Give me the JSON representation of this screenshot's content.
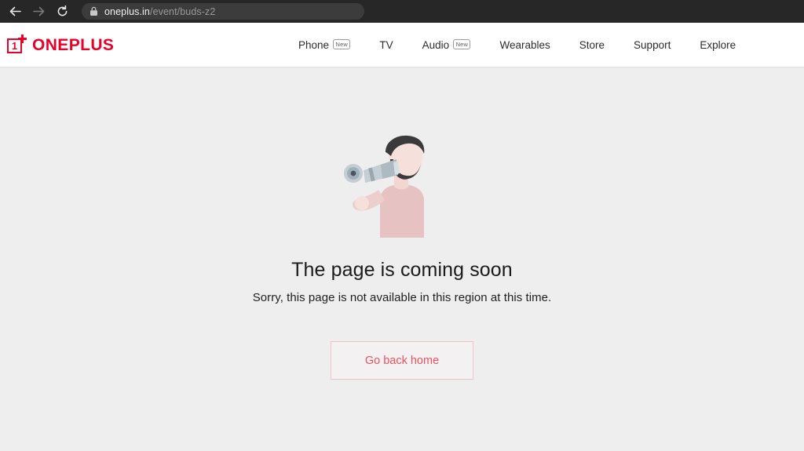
{
  "browser": {
    "back_icon": "back-arrow-icon",
    "forward_icon": "forward-arrow-icon",
    "reload_icon": "reload-icon",
    "lock_icon": "lock-icon",
    "url_domain": "oneplus.in",
    "url_path": "/event/buds-z2"
  },
  "header": {
    "logo_symbol": "1",
    "brand": "ONEPLUS",
    "nav": [
      {
        "label": "Phone",
        "badge": "New"
      },
      {
        "label": "TV",
        "badge": ""
      },
      {
        "label": "Audio",
        "badge": "New"
      },
      {
        "label": "Wearables",
        "badge": ""
      },
      {
        "label": "Store",
        "badge": ""
      },
      {
        "label": "Support",
        "badge": ""
      },
      {
        "label": "Explore",
        "badge": ""
      }
    ]
  },
  "main": {
    "illustration_name": "man-with-telescope-illustration",
    "headline": "The page is coming soon",
    "subtext": "Sorry, this page is not available in this region at this time.",
    "button_label": "Go back home"
  },
  "colors": {
    "brand_red": "#eb0029",
    "button_text": "#e8535f",
    "button_border": "#ecc3c7",
    "page_bg": "#eeeeee",
    "chrome_bg": "#272727",
    "shirt_pink": "#e7c2c2",
    "skin": "#f6e0dc",
    "hair_dark": "#3a3a3a",
    "telescope_grey": "#b9c4cb"
  }
}
